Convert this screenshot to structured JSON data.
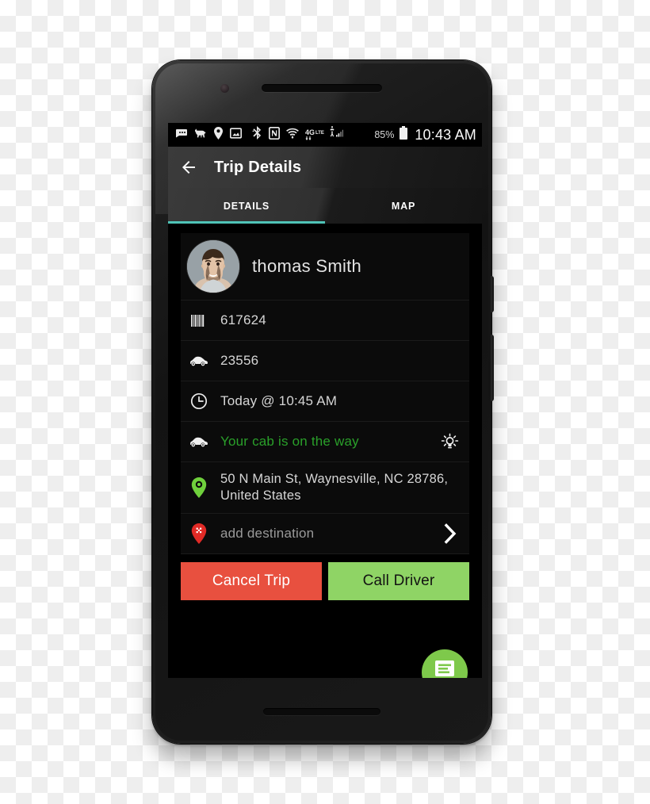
{
  "background": {
    "pattern": "transparency-checkerboard"
  },
  "device": {
    "name": "android-smartphone",
    "hardware": {
      "earpiece": "earpiece-speaker",
      "front_camera": "front-camera",
      "bottom_speaker": "bottom-speaker",
      "power_button": "power-button",
      "volume_button": "volume-button"
    }
  },
  "statusbar": {
    "icons": [
      {
        "name": "messages-icon"
      },
      {
        "name": "dog-icon"
      },
      {
        "name": "location-pin-icon"
      },
      {
        "name": "screenshot-icon"
      },
      {
        "name": "bluetooth-icon"
      },
      {
        "name": "nfc-icon"
      },
      {
        "name": "wifi-icon"
      },
      {
        "name": "4g-lte-icon",
        "label": "4G"
      },
      {
        "name": "cellular-signal-icon"
      }
    ],
    "battery_percent": "85%",
    "battery_icon": "battery-icon",
    "clock": "10:43 AM"
  },
  "appbar": {
    "back_icon": "back-arrow-icon",
    "title": "Trip Details"
  },
  "tabs": {
    "items": [
      {
        "label": "DETAILS",
        "active": true
      },
      {
        "label": "MAP",
        "active": false
      }
    ],
    "indicator_color": "#4fc3b7"
  },
  "details": {
    "profile": {
      "avatar_name": "driver-avatar",
      "name": "thomas Smith"
    },
    "rows": [
      {
        "icon": "barcode-icon",
        "text": "617624",
        "style": "normal"
      },
      {
        "icon": "car-icon",
        "text": "23556",
        "style": "normal"
      },
      {
        "icon": "clock-icon",
        "text": "Today @ 10:45 AM",
        "style": "normal"
      },
      {
        "icon": "car-icon",
        "text": "Your cab is on the way",
        "style": "green",
        "end_icon": "brightness-bulb-icon"
      },
      {
        "icon": "pickup-pin-icon",
        "text": "50 N Main St, Waynesville, NC 28786, United States",
        "style": "address"
      },
      {
        "icon": "destination-pin-icon",
        "text": "add destination",
        "style": "muted",
        "end_icon": "chevron-right-icon"
      }
    ]
  },
  "actions": {
    "cancel_label": "Cancel Trip",
    "cancel_color": "#e8503f",
    "call_label": "Call Driver",
    "call_color": "#8fd465"
  },
  "fab": {
    "name": "chat-fab",
    "icon": "message-icon",
    "color": "#7ec94b"
  }
}
